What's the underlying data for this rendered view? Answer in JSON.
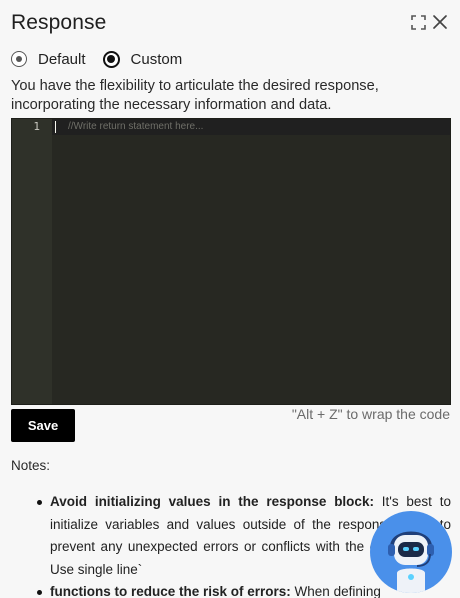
{
  "panel": {
    "title": "Response",
    "expand_icon": "expand-icon",
    "close_icon": "close-icon"
  },
  "mode": {
    "options": [
      {
        "label": "Default",
        "selected": false
      },
      {
        "label": "Custom",
        "selected": true
      }
    ]
  },
  "description": "You have the flexibility to articulate the desired response, incorporating the necessary information and data.",
  "editor": {
    "line_number": "1",
    "placeholder": "//Write return statement here..."
  },
  "save_label": "Save",
  "wrap_hint": "\"Alt + Z\" to wrap the code",
  "notes_label": "Notes:",
  "notes": [
    {
      "title": "Avoid initializing values in the response block:",
      "body": " It's best to initialize variables and values outside of the response block to prevent any unexpected errors or conflicts with the existing data. Use single line`"
    },
    {
      "title": "functions to reduce the risk of errors:",
      "body": " When defining"
    }
  ],
  "assistant": {
    "icon": "robot-assistant-icon",
    "colors": {
      "bubble": "#4a90ea"
    }
  },
  "colors": {
    "editor_bg": "#272822",
    "gutter_bg": "#2f3129",
    "button_bg": "#000000"
  }
}
